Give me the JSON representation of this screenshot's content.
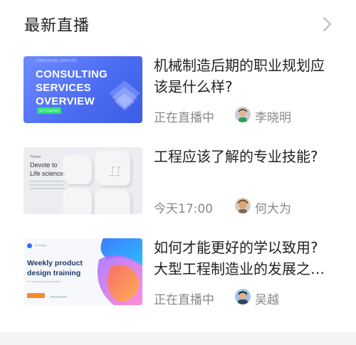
{
  "header": {
    "title": "最新直播",
    "chevron_icon": "chevron-right-icon"
  },
  "items": [
    {
      "title_lines": [
        "机械制造后期的职业规划应",
        "该是什么样?"
      ],
      "status": "正在直播中",
      "author": "李晓明",
      "thumb": {
        "top_text": "CONSULTING SERVICES",
        "heading_lines": [
          "CONSULTING",
          "SERVICES",
          "OVERVIEW"
        ],
        "button_label": "GET STARTED"
      }
    },
    {
      "title_lines": [
        "工程应该了解的专业技能?"
      ],
      "status": "今天17:00",
      "author": "何大为",
      "thumb": {
        "small_label": "Theme",
        "heading_lines": [
          "Devote to",
          "Life sciences"
        ],
        "key_symbol": "π"
      }
    },
    {
      "title_lines": [
        "如何才能更好的学以致用?",
        "大型工程制造业的发展之…"
      ],
      "status": "正在直播中",
      "author": "吴越",
      "thumb": {
        "logo_text": "UI Design",
        "heading_lines": [
          "Weekly product",
          "design training"
        ],
        "sub_text": "It's an amazing experience"
      }
    }
  ],
  "colors": {
    "title": "#222222",
    "meta": "#888888",
    "accent_blue": "#4c6df2",
    "accent_green": "#2ee27a",
    "accent_orange": "#f48a2a"
  }
}
